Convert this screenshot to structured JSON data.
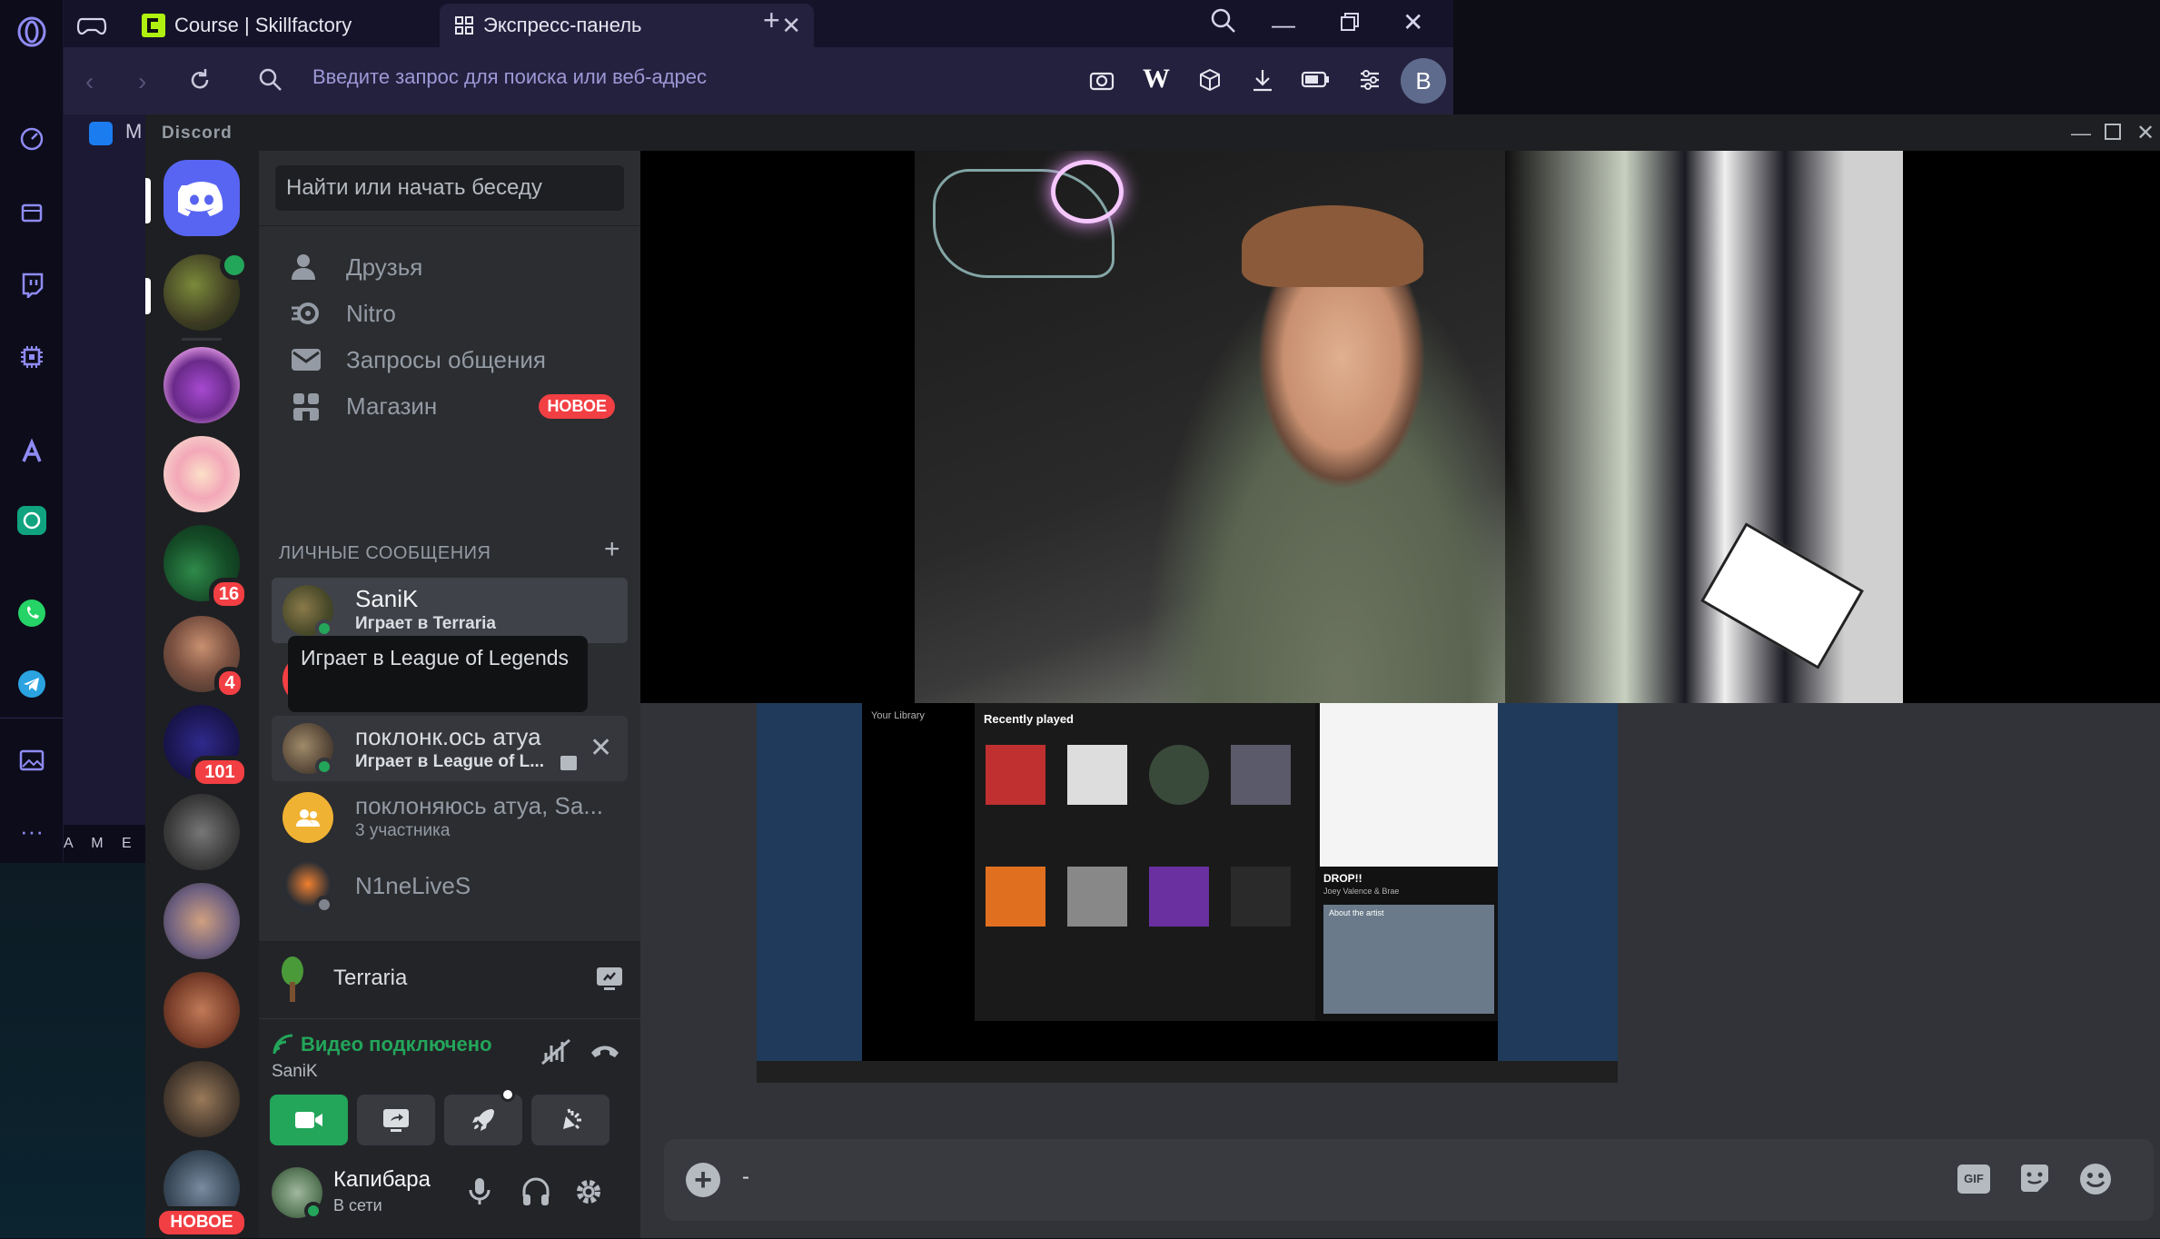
{
  "browser": {
    "tabs": [
      {
        "label": "Course | Skillfactory"
      },
      {
        "label": "Экспресс-панель"
      }
    ],
    "address_placeholder": "Введите запрос для поиска или веб-адрес",
    "profile_initial": "B",
    "strip_labels": {
      "mail": "M",
      "game": "A M E"
    }
  },
  "discord": {
    "title": "Discord",
    "search_placeholder": "Найти или начать беседу",
    "nav": [
      {
        "label": "Друзья",
        "icon": "friends-icon"
      },
      {
        "label": "Nitro",
        "icon": "nitro-icon"
      },
      {
        "label": "Запросы общения",
        "icon": "message-requests-icon"
      },
      {
        "label": "Магазин",
        "icon": "shop-icon",
        "badge": "НОВОЕ"
      }
    ],
    "dm_header": "ЛИЧНЫЕ СООБЩЕНИЯ",
    "dms": [
      {
        "name": "SaniK",
        "status": "Играет в Terraria"
      },
      {
        "name": "поклонк.ось атуа",
        "status": "Играет в League of L..."
      },
      {
        "name": "поклоняюсь атуа, Sa...",
        "status": "3 участника"
      },
      {
        "name": "N1neLiveS",
        "status": ""
      }
    ],
    "tooltip": "Играет в League of Legends",
    "guild_badges": [
      "16",
      "4",
      "101"
    ],
    "guild_new_badge": "НОВОЕ",
    "activity": {
      "game": "Terraria"
    },
    "voice": {
      "status": "Видео подключено",
      "channel": "SaniK"
    },
    "user": {
      "name": "Капибара",
      "status": "В сети"
    },
    "composer": {
      "text": "-",
      "gif": "GIF"
    }
  },
  "stream": {
    "spotify": {
      "library": "Your Library",
      "recently_played": "Recently played",
      "album_title": "DROP!!",
      "album_artist": "Joey Valence & Brae",
      "about": "About the artist"
    }
  }
}
